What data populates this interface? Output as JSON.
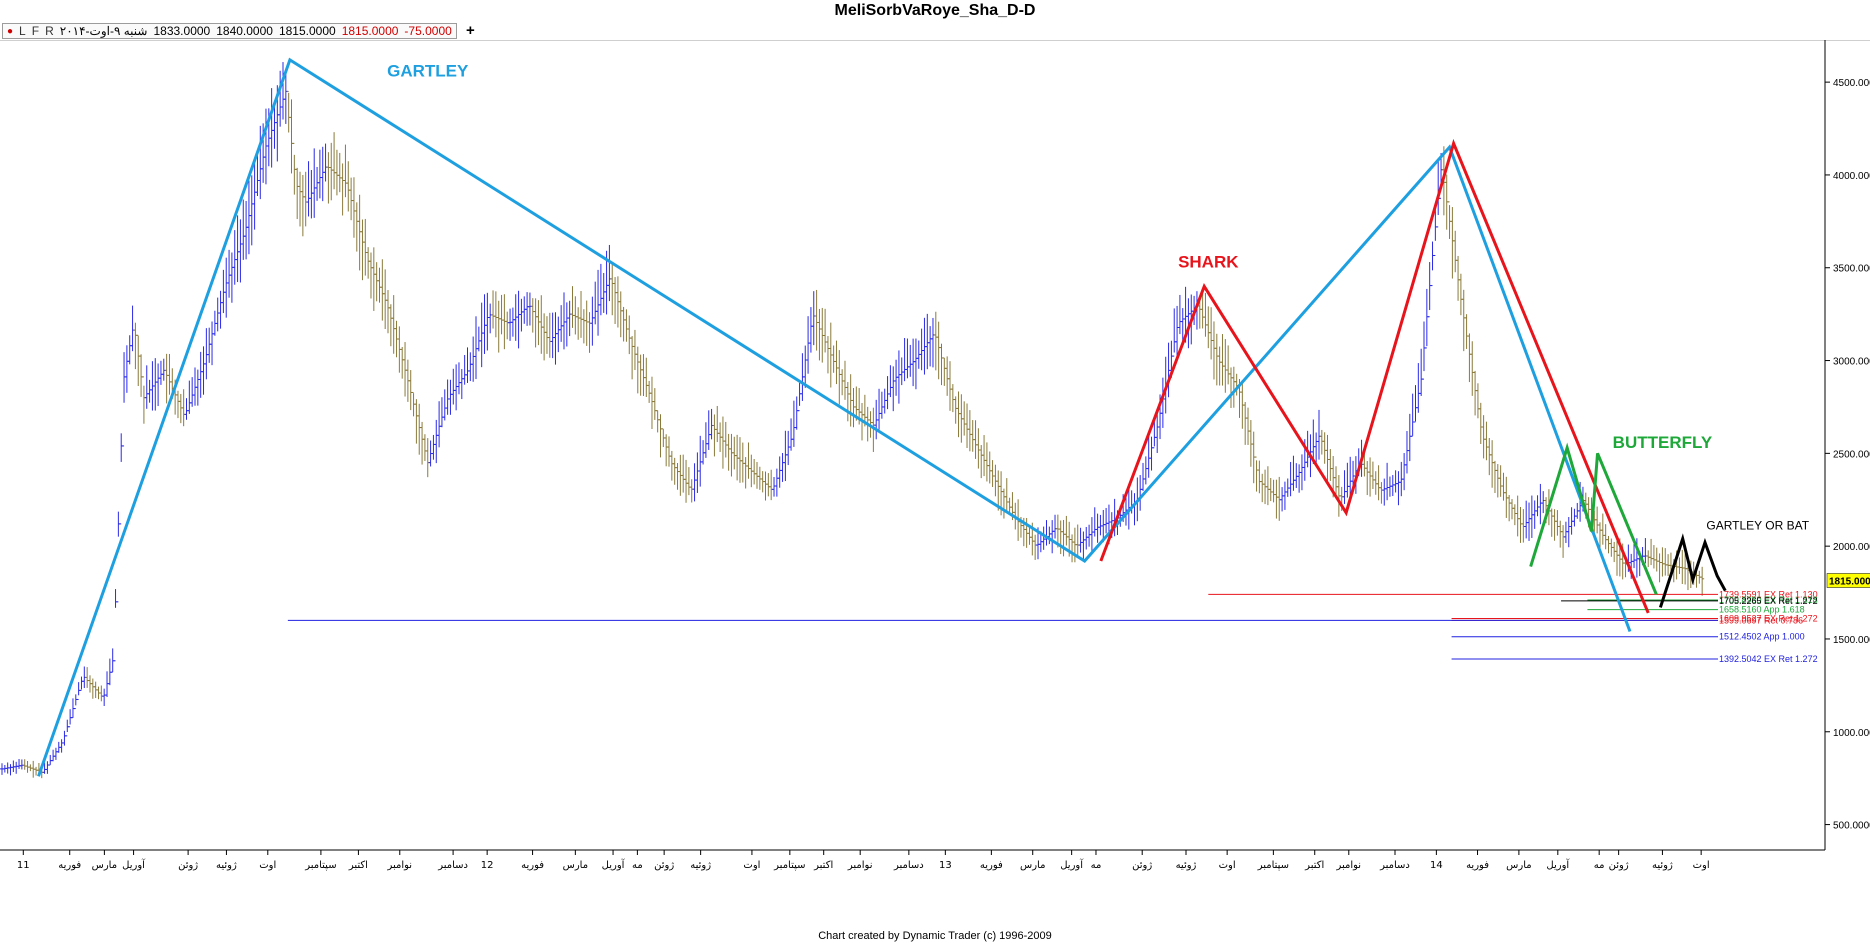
{
  "window": {
    "title": "MeliSorbVaRoye_Sha_D-D"
  },
  "info": {
    "markers": [
      "L",
      "F",
      "R"
    ],
    "date": "شنبه ۹-اوت-۲۰۱۴",
    "open": "1833.0000",
    "high": "1840.0000",
    "low": "1815.0000",
    "close": "1815.0000",
    "change": "-75.0000",
    "plus": "+"
  },
  "footer": "Chart created by Dynamic Trader  (c) 1996-2009",
  "chart_data": {
    "type": "line",
    "title": "MeliSorbVaRoye_Sha_D-D",
    "xlabel": "",
    "ylabel": "",
    "x_range": [
      0,
      84
    ],
    "ylim": [
      363,
      4727
    ],
    "y_ticks": [
      500,
      1000,
      1500,
      2000,
      2500,
      3000,
      3500,
      4000,
      4500
    ],
    "y_tick_labels": [
      "500.0000",
      "1000.0000",
      "1500.0000",
      "2000.0000",
      "2500.0000",
      "3000.0000",
      "3500.0000",
      "4000.0000",
      "4500.0000"
    ],
    "last_price": {
      "label": "1815.0000",
      "value": 1815,
      "color": "#ffff00"
    },
    "x_ticks": [
      {
        "x": 1.05,
        "label": "11"
      },
      {
        "x": 3.34,
        "label": "فوریه"
      },
      {
        "x": 5.05,
        "label": "مارس"
      },
      {
        "x": 6.49,
        "label": "آوریل"
      },
      {
        "x": 9.18,
        "label": "ژوئن"
      },
      {
        "x": 11.07,
        "label": "ژوئیه"
      },
      {
        "x": 13.11,
        "label": "اوت"
      },
      {
        "x": 15.73,
        "label": "سپتامبر"
      },
      {
        "x": 17.58,
        "label": "اکتبر"
      },
      {
        "x": 19.62,
        "label": "نوامبر"
      },
      {
        "x": 22.25,
        "label": "دسامبر"
      },
      {
        "x": 23.93,
        "label": "12"
      },
      {
        "x": 26.17,
        "label": "فوریه"
      },
      {
        "x": 28.28,
        "label": "مارس"
      },
      {
        "x": 30.14,
        "label": "آوریل"
      },
      {
        "x": 31.34,
        "label": "مه"
      },
      {
        "x": 32.66,
        "label": "ژوئن"
      },
      {
        "x": 34.46,
        "label": "ژوئیه"
      },
      {
        "x": 36.99,
        "label": "اوت"
      },
      {
        "x": 38.86,
        "label": "سپتامبر"
      },
      {
        "x": 40.53,
        "label": "اکتبر"
      },
      {
        "x": 42.33,
        "label": "نوامبر"
      },
      {
        "x": 44.73,
        "label": "دسامبر"
      },
      {
        "x": 46.53,
        "label": "13"
      },
      {
        "x": 48.8,
        "label": "فوریه"
      },
      {
        "x": 50.84,
        "label": "مارس"
      },
      {
        "x": 52.76,
        "label": "آوریل"
      },
      {
        "x": 53.96,
        "label": "مه"
      },
      {
        "x": 56.24,
        "label": "ژوئن"
      },
      {
        "x": 58.4,
        "label": "ژوئیه"
      },
      {
        "x": 60.43,
        "label": "اوت"
      },
      {
        "x": 62.71,
        "label": "سپتامبر"
      },
      {
        "x": 64.75,
        "label": "اکتبر"
      },
      {
        "x": 66.43,
        "label": "نوامبر"
      },
      {
        "x": 68.71,
        "label": "دسامبر"
      },
      {
        "x": 70.75,
        "label": "14"
      },
      {
        "x": 72.78,
        "label": "فوریه"
      },
      {
        "x": 74.82,
        "label": "مارس"
      },
      {
        "x": 76.74,
        "label": "آوریل"
      },
      {
        "x": 78.78,
        "label": "مه"
      },
      {
        "x": 79.74,
        "label": "ژوئن"
      },
      {
        "x": 81.9,
        "label": "ژوئیه"
      },
      {
        "x": 83.81,
        "label": "اوت"
      }
    ],
    "price_path": [
      {
        "x": 0,
        "y": 800
      },
      {
        "x": 1,
        "y": 820
      },
      {
        "x": 2,
        "y": 780
      },
      {
        "x": 3,
        "y": 950
      },
      {
        "x": 4,
        "y": 1300
      },
      {
        "x": 5,
        "y": 1180
      },
      {
        "x": 5.5,
        "y": 1400
      },
      {
        "x": 6,
        "y": 2900
      },
      {
        "x": 6.5,
        "y": 3200
      },
      {
        "x": 7,
        "y": 2800
      },
      {
        "x": 8,
        "y": 2950
      },
      {
        "x": 9,
        "y": 2700
      },
      {
        "x": 10,
        "y": 3000
      },
      {
        "x": 11,
        "y": 3400
      },
      {
        "x": 12,
        "y": 3700
      },
      {
        "x": 13,
        "y": 4150
      },
      {
        "x": 14,
        "y": 4450
      },
      {
        "x": 14.5,
        "y": 3950
      },
      {
        "x": 15,
        "y": 3850
      },
      {
        "x": 16,
        "y": 4050
      },
      {
        "x": 17,
        "y": 3950
      },
      {
        "x": 18,
        "y": 3550
      },
      {
        "x": 19,
        "y": 3300
      },
      {
        "x": 20,
        "y": 2900
      },
      {
        "x": 21,
        "y": 2450
      },
      {
        "x": 22,
        "y": 2800
      },
      {
        "x": 23,
        "y": 2950
      },
      {
        "x": 24,
        "y": 3250
      },
      {
        "x": 25,
        "y": 3200
      },
      {
        "x": 26,
        "y": 3300
      },
      {
        "x": 27,
        "y": 3100
      },
      {
        "x": 28,
        "y": 3250
      },
      {
        "x": 29,
        "y": 3200
      },
      {
        "x": 30,
        "y": 3450
      },
      {
        "x": 31,
        "y": 3100
      },
      {
        "x": 32,
        "y": 2800
      },
      {
        "x": 33,
        "y": 2450
      },
      {
        "x": 34,
        "y": 2300
      },
      {
        "x": 35,
        "y": 2650
      },
      {
        "x": 36,
        "y": 2500
      },
      {
        "x": 37,
        "y": 2400
      },
      {
        "x": 38,
        "y": 2300
      },
      {
        "x": 39,
        "y": 2600
      },
      {
        "x": 40,
        "y": 3250
      },
      {
        "x": 41,
        "y": 3000
      },
      {
        "x": 42,
        "y": 2750
      },
      {
        "x": 43,
        "y": 2650
      },
      {
        "x": 44,
        "y": 2900
      },
      {
        "x": 45,
        "y": 3000
      },
      {
        "x": 46,
        "y": 3150
      },
      {
        "x": 47,
        "y": 2750
      },
      {
        "x": 48,
        "y": 2550
      },
      {
        "x": 49,
        "y": 2350
      },
      {
        "x": 50,
        "y": 2150
      },
      {
        "x": 51,
        "y": 2000
      },
      {
        "x": 52,
        "y": 2100
      },
      {
        "x": 53,
        "y": 2000
      },
      {
        "x": 54,
        "y": 2100
      },
      {
        "x": 55,
        "y": 2150
      },
      {
        "x": 56,
        "y": 2250
      },
      {
        "x": 57,
        "y": 2650
      },
      {
        "x": 58,
        "y": 3200
      },
      {
        "x": 59,
        "y": 3300
      },
      {
        "x": 60,
        "y": 3000
      },
      {
        "x": 61,
        "y": 2850
      },
      {
        "x": 62,
        "y": 2350
      },
      {
        "x": 63,
        "y": 2250
      },
      {
        "x": 64,
        "y": 2400
      },
      {
        "x": 65,
        "y": 2600
      },
      {
        "x": 66,
        "y": 2250
      },
      {
        "x": 67,
        "y": 2450
      },
      {
        "x": 68,
        "y": 2300
      },
      {
        "x": 69,
        "y": 2350
      },
      {
        "x": 70,
        "y": 2900
      },
      {
        "x": 70.5,
        "y": 3500
      },
      {
        "x": 71,
        "y": 4050
      },
      {
        "x": 72,
        "y": 3300
      },
      {
        "x": 73,
        "y": 2600
      },
      {
        "x": 74,
        "y": 2300
      },
      {
        "x": 75,
        "y": 2100
      },
      {
        "x": 76,
        "y": 2250
      },
      {
        "x": 77,
        "y": 2050
      },
      {
        "x": 78,
        "y": 2250
      },
      {
        "x": 79,
        "y": 2050
      },
      {
        "x": 80,
        "y": 1900
      },
      {
        "x": 81,
        "y": 1950
      },
      {
        "x": 82,
        "y": 1900
      },
      {
        "x": 83,
        "y": 1880
      },
      {
        "x": 84,
        "y": 1815
      }
    ],
    "patterns": [
      {
        "name": "GARTLEY",
        "color": "#1ea0e0",
        "points": [
          {
            "x": 1.8,
            "y": 760
          },
          {
            "x": 14.2,
            "y": 4620
          },
          {
            "x": 53.4,
            "y": 1920
          },
          {
            "x": 71.4,
            "y": 4150
          },
          {
            "x": 80.3,
            "y": 1540
          }
        ]
      },
      {
        "name": "SHARK",
        "color": "#e8141c",
        "points": [
          {
            "x": 54.2,
            "y": 1920
          },
          {
            "x": 59.3,
            "y": 3400
          },
          {
            "x": 66.3,
            "y": 2180
          },
          {
            "x": 71.6,
            "y": 4170
          },
          {
            "x": 81.2,
            "y": 1640
          }
        ]
      },
      {
        "name": "BUTTERFLY",
        "color": "#1ea83a",
        "points": [
          {
            "x": 75.4,
            "y": 1890
          },
          {
            "x": 77.2,
            "y": 2530
          },
          {
            "x": 78.4,
            "y": 2080
          },
          {
            "x": 78.7,
            "y": 2500
          },
          {
            "x": 81.6,
            "y": 1740
          }
        ]
      },
      {
        "name": "GARTLEY OR BAT",
        "color": "#000000",
        "points": [
          {
            "x": 81.8,
            "y": 1670
          },
          {
            "x": 82.9,
            "y": 2040
          },
          {
            "x": 83.4,
            "y": 1820
          },
          {
            "x": 84.0,
            "y": 2020
          },
          {
            "x": 84.6,
            "y": 1840
          },
          {
            "x": 85.0,
            "y": 1760
          }
        ]
      }
    ],
    "annotations": [
      {
        "text": "GARTLEY",
        "color": "#1ea0e0",
        "x": 21,
        "y": 4530
      },
      {
        "text": "SHARK",
        "color": "#e8141c",
        "x": 59.5,
        "y": 3500
      },
      {
        "text": "BUTTERFLY",
        "color": "#1ea83a",
        "x": 81.9,
        "y": 2530
      },
      {
        "text": "GARTLEY OR BAT",
        "color": "#000000",
        "x": 86.6,
        "y": 2090
      }
    ],
    "levels": [
      {
        "value": 1740,
        "label": "1739.5591 EX Ret 1.130",
        "color": "#e8141c",
        "x_from": 59.5
      },
      {
        "value": 1710,
        "label": "1709.8980 EX Ret 1.618",
        "color": "#1ea83a",
        "x_from": 78.2
      },
      {
        "value": 1705,
        "label": "1705.2265 EX Ret 1.272",
        "color": "#000000",
        "x_from": 76.9
      },
      {
        "value": 1658,
        "label": "1658.5160 App 1.618",
        "color": "#1ea83a",
        "x_from": 78.2
      },
      {
        "value": 1610,
        "label": "1609.9527 EX Ret 1.272",
        "color": "#e8141c",
        "x_from": 71.5
      },
      {
        "value": 1600,
        "label": "1599.0697 Ret 0.786",
        "color": "#e8141c",
        "x_from": 71.5
      },
      {
        "value": 1600,
        "label": "",
        "color": "#2020e0",
        "x_from": 14.1
      },
      {
        "value": 1512,
        "label": "1512.4502 App 1.000",
        "color": "#2020e0",
        "x_from": 71.5
      },
      {
        "value": 1392,
        "label": "1392.5042 EX Ret 1.272",
        "color": "#2020e0",
        "x_from": 71.5
      }
    ]
  }
}
